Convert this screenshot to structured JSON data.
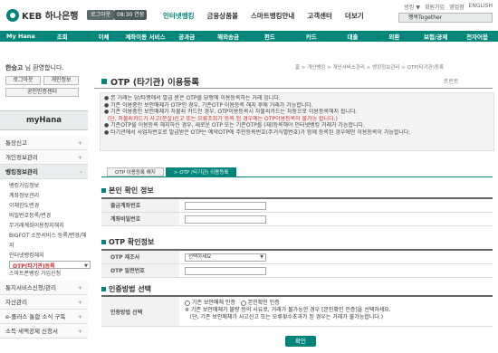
{
  "brand": {
    "name": "KEB 하나은행"
  },
  "header": {
    "login": "로그아웃",
    "timer": "08:30 연장",
    "nav": [
      "인터넷뱅킹",
      "금융상품몰",
      "스마트뱅킹안내",
      "고객센터",
      "더보기"
    ],
    "util": [
      "방킹 ▼",
      "회원가입",
      "영업점",
      "ENGLISH"
    ],
    "search": "행복Together"
  },
  "mainnav": [
    "My Hana",
    "조회",
    "이체",
    "계좌이동 서비스",
    "공과금",
    "해외송금",
    "펀드",
    "카드",
    "대출",
    "외환",
    "보험/공제",
    "전자어음"
  ],
  "sidebar": {
    "greeting_name": "한승고",
    "greeting_suffix": "님 환영합니다.",
    "btn_logout": "로그아웃",
    "btn_profile": "개인정보",
    "btn_cert": "공인인증센터",
    "title": "myHana",
    "items": [
      "통장신고",
      "개인정보관리",
      "뱅킹정보관리"
    ],
    "subitems": [
      "뱅킹가입정보",
      "계좌정보관리",
      "이체한도변경",
      "비밀번호등록/변경",
      "무거래계좌이용정지해지",
      "BIGFOT 소문서비스 등록/변경/해지",
      "인터넷뱅킹해지",
      "OTP(타기관)등록",
      "스마트폰뱅킹 가입신청"
    ],
    "lower": [
      "통지서비스신청/관리",
      "자산관리",
      "e-플러스 통합 소식 구독",
      "소득·세액공제 신청서"
    ]
  },
  "breadcrumb": "홈 > 개인뱅킹 > 개인서비스관리 > 뱅킹정보관리 > OTP(타기관)등록",
  "page": {
    "title": "OTP (타기관) 이용등록",
    "print": "프린트"
  },
  "notices": [
    "본 거래는 당/타행에서 발급 받은 OTP를 당행에 이용등록하는 거래 입니다.",
    "기존 이용중인 보안매체가 OTP인 경우, 기존OTP 이용등록 해지 후에 거래가 가능합니다.",
    "기존 이용중인 보안매체가 자물쇠 카드인 경우, OTP이용등록시 자물쇠카드는 자동으로 이용등록해지 됩니다.",
    "(단, 자물쇠카드가 사고(분실)신고 또는 오류조회가 등록 된 경우에는 OTP이용등록이 불가능 합니다.)",
    "기존OTP를 이용등록 해지하신 경우, 새로운 OTP 또는 기존OTP를 (재)등록해야 인터넷뱅킹 거래가 가능합니다.",
    "타기관에서 사업자번호로 발급받은 OTP는 예약OTP에 주민등록번호(주거식별번호)가 함께 등록된 경우에만 이용등록이 가능합니다."
  ],
  "tabs": [
    "OTP 이용등록 해지",
    "> OTP (타기관) 이용등록"
  ],
  "sections": {
    "identity": "본인 확인 정보",
    "otp": "OTP 확인정보",
    "auth": "인증방법 선택"
  },
  "identity": {
    "account_label": "출금계좌번호",
    "password_label": "계좌비밀번호"
  },
  "otp": {
    "maker_label": "OTP 제조사",
    "maker_value": "선택하세요",
    "serial_label": "OTP 일련번호"
  },
  "auth": {
    "label": "인증방법 선택",
    "opt1": "기존 보안매체 인증",
    "opt2": "본인확인 인증",
    "note1": "기존 보안매체가 불량 등의 사유로, 거래가 불가능한 경우 [본인확인 인증]을 선택하세요.",
    "note2": "(단, 기존 보안매체가 사고신고 또는 오류횟수초과가 된 경우는 거래가 불가능합니다.)"
  },
  "confirm": "확인"
}
